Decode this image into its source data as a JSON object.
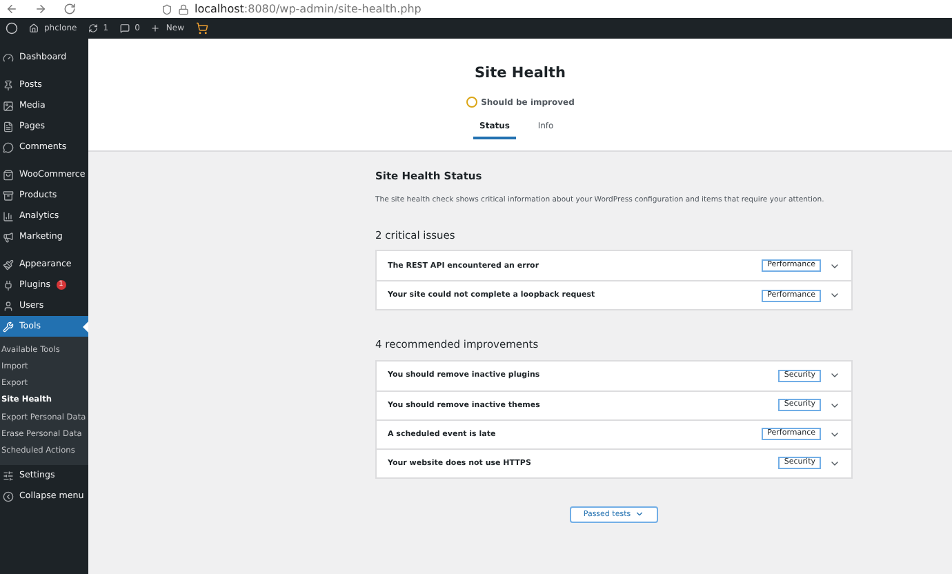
{
  "browser": {
    "url_host": "localhost",
    "url_rest": ":8080/wp-admin/site-health.php"
  },
  "admin_bar": {
    "site": "phclone",
    "updates": "1",
    "comments": "0",
    "new": "New"
  },
  "sidebar": {
    "groups": [
      {
        "items": [
          {
            "label": "Dashboard",
            "selected": false
          }
        ]
      },
      {
        "items": [
          {
            "label": "Posts",
            "selected": false
          },
          {
            "label": "Media",
            "selected": false
          },
          {
            "label": "Pages",
            "selected": false
          },
          {
            "label": "Comments",
            "selected": false
          }
        ]
      },
      {
        "items": [
          {
            "label": "WooCommerce",
            "selected": false
          },
          {
            "label": "Products",
            "selected": false
          },
          {
            "label": "Analytics",
            "selected": false
          },
          {
            "label": "Marketing",
            "selected": false
          }
        ]
      },
      {
        "items": [
          {
            "label": "Appearance",
            "selected": false
          },
          {
            "label": "Plugins",
            "selected": false,
            "badge": "1"
          },
          {
            "label": "Users",
            "selected": false
          },
          {
            "label": "Tools",
            "selected": true,
            "children": [
              {
                "label": "Available Tools",
                "selected": false
              },
              {
                "label": "Import",
                "selected": false
              },
              {
                "label": "Export",
                "selected": false
              },
              {
                "label": "Site Health",
                "selected": true
              },
              {
                "label": "Export Personal Data",
                "selected": false
              },
              {
                "label": "Erase Personal Data",
                "selected": false
              },
              {
                "label": "Scheduled Actions",
                "selected": false
              }
            ]
          },
          {
            "label": "Settings",
            "selected": false
          },
          {
            "label": "Collapse menu",
            "selected": false
          }
        ]
      }
    ]
  },
  "header": {
    "title": "Site Health",
    "status": "Should be improved",
    "tabs": [
      {
        "label": "Status",
        "selected": true
      },
      {
        "label": "Info",
        "selected": false
      }
    ]
  },
  "status": {
    "title": "Site Health Status",
    "description": "The site health check shows critical information about your WordPress configuration and items that require your attention."
  },
  "sections": [
    {
      "title": "2 critical issues",
      "items": [
        {
          "label": "The REST API encountered an error",
          "tag": "Performance"
        },
        {
          "label": "Your site could not complete a loopback request",
          "tag": "Performance"
        }
      ]
    },
    {
      "title": "4 recommended improvements",
      "items": [
        {
          "label": "You should remove inactive plugins",
          "tag": "Security"
        },
        {
          "label": "You should remove inactive themes",
          "tag": "Security"
        },
        {
          "label": "A scheduled event is late",
          "tag": "Performance"
        },
        {
          "label": "Your website does not use HTTPS",
          "tag": "Security"
        }
      ]
    }
  ],
  "passed_button": "Passed tests"
}
